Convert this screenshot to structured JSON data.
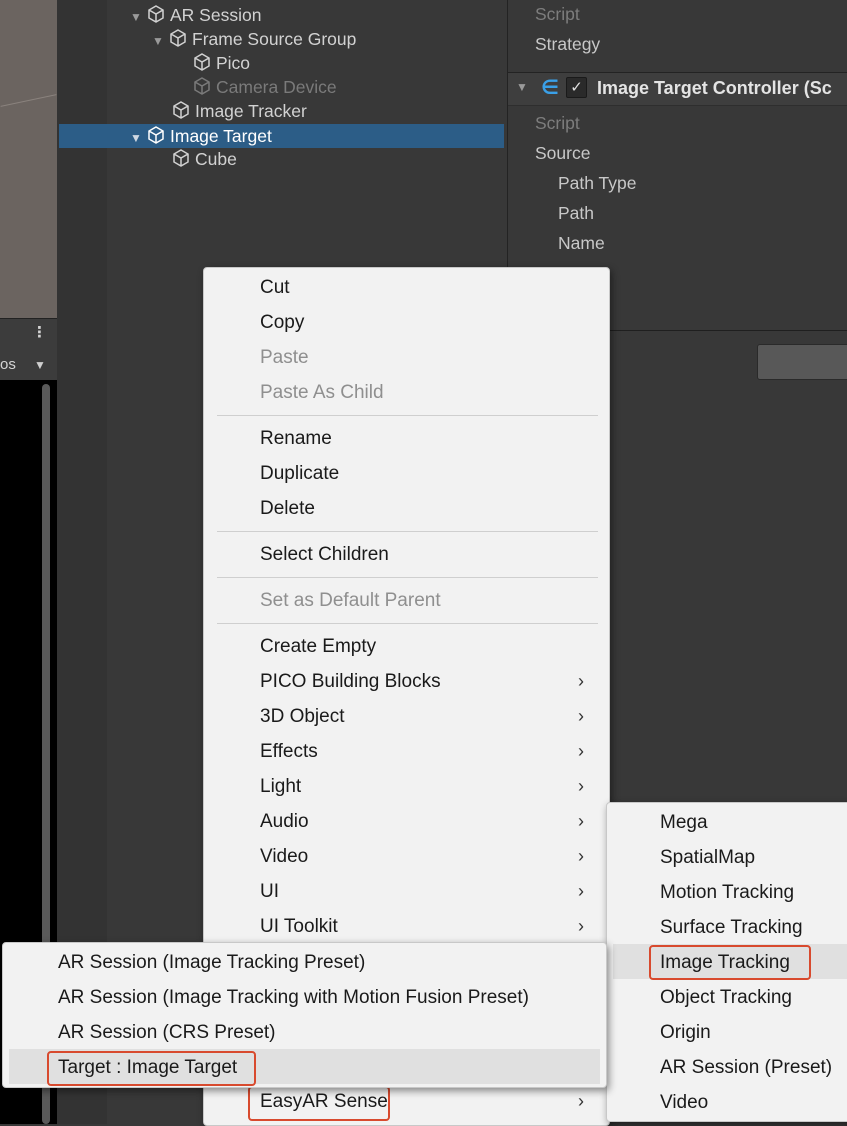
{
  "game_view": {
    "toolbar_label": "os",
    "dropdown_icon": "caret-down-icon",
    "menu_icon": "kebab-icon"
  },
  "hierarchy": {
    "rows": [
      {
        "label": "AR Session"
      },
      {
        "label": "Frame Source Group"
      },
      {
        "label": "Pico"
      },
      {
        "label": "Camera Device"
      },
      {
        "label": "Image Tracker"
      },
      {
        "label": "Image Target"
      },
      {
        "label": "Cube"
      }
    ]
  },
  "inspector": {
    "script_label_1": "Script",
    "strategy_label": "Strategy",
    "component_title": "Image Target Controller (Sc",
    "script_label_2": "Script",
    "source_label": "Source",
    "path_type_label": "Path Type",
    "path_label": "Path",
    "name_label": "Name"
  },
  "context_menu": {
    "items": [
      {
        "label": "Cut"
      },
      {
        "label": "Copy"
      },
      {
        "label": "Paste"
      },
      {
        "label": "Paste As Child"
      },
      {
        "label": "Rename"
      },
      {
        "label": "Duplicate"
      },
      {
        "label": "Delete"
      },
      {
        "label": "Select Children"
      },
      {
        "label": "Set as Default Parent"
      },
      {
        "label": "Create Empty"
      },
      {
        "label": "PICO Building Blocks"
      },
      {
        "label": "3D Object"
      },
      {
        "label": "Effects"
      },
      {
        "label": "Light"
      },
      {
        "label": "Audio"
      },
      {
        "label": "Video"
      },
      {
        "label": "UI"
      },
      {
        "label": "UI Toolkit"
      },
      {
        "label": "EasyAR Sense"
      }
    ]
  },
  "easyar_submenu": {
    "items": [
      {
        "label": "Mega"
      },
      {
        "label": "SpatialMap"
      },
      {
        "label": "Motion Tracking"
      },
      {
        "label": "Surface Tracking"
      },
      {
        "label": "Image Tracking"
      },
      {
        "label": "Object Tracking"
      },
      {
        "label": "Origin"
      },
      {
        "label": "AR Session (Preset)"
      },
      {
        "label": "Video"
      }
    ]
  },
  "image_tracking_submenu": {
    "items": [
      {
        "label": "AR Session (Image Tracking Preset)"
      },
      {
        "label": "AR Session (Image Tracking with Motion Fusion Preset)"
      },
      {
        "label": "AR Session (CRS Preset)"
      },
      {
        "label": "Target : Image Target"
      }
    ]
  },
  "colors": {
    "highlight_border": "#d84a2e",
    "selection": "#2c5d87",
    "menu_bg": "#f2f2f2"
  }
}
